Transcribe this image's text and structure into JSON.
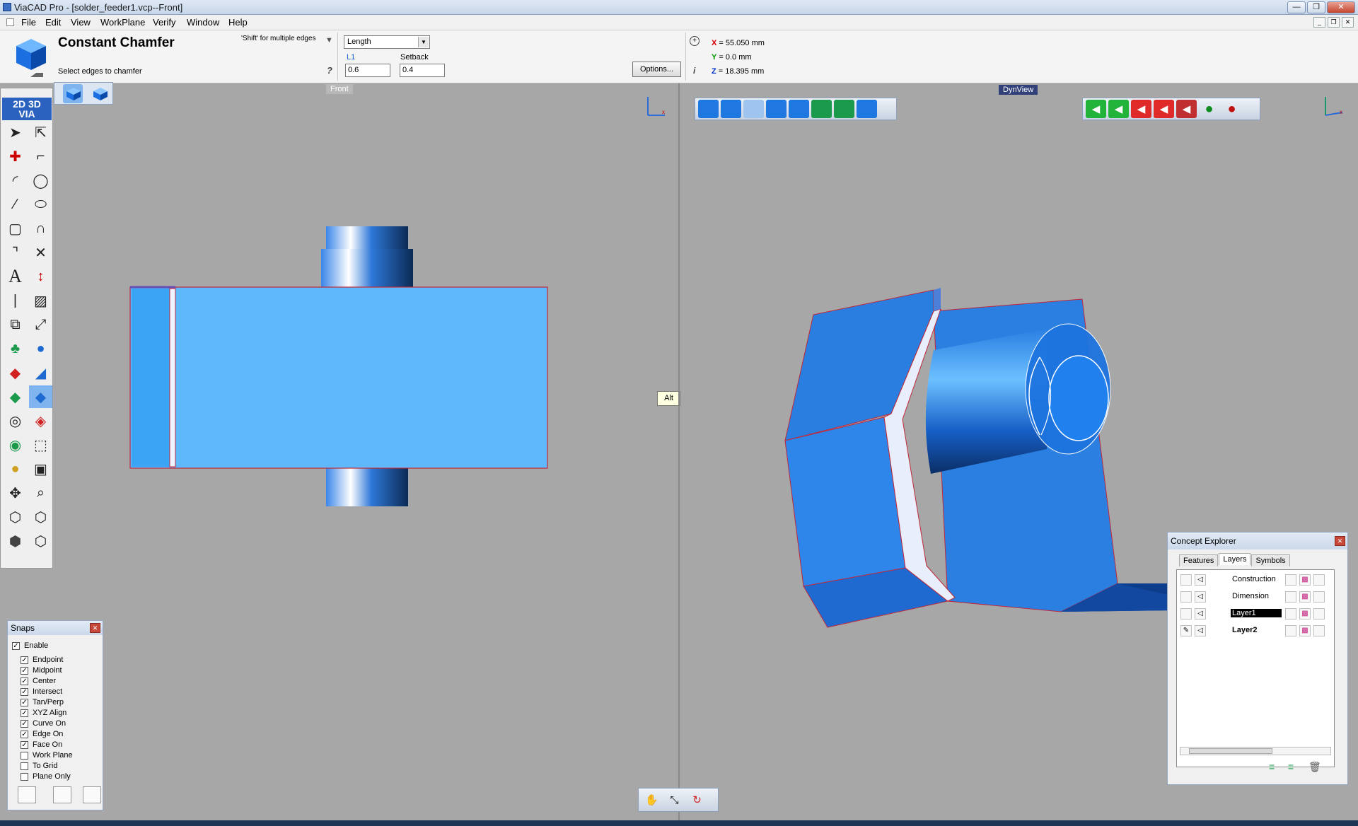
{
  "window": {
    "title": "ViaCAD Pro - [solder_feeder1.vcp--Front]"
  },
  "menu": [
    "File",
    "Edit",
    "View",
    "WorkPlane",
    "Verify",
    "Window",
    "Help"
  ],
  "command": {
    "title": "Constant Chamfer",
    "prompt": "Select edges to chamfer",
    "hint": "'Shift' for multiple edges",
    "help_mark": "?",
    "mode": "Length",
    "l1_label": "L1",
    "l1_value": "0.6",
    "setback_label": "Setback",
    "setback_value": "0.4",
    "options_label": "Options...",
    "info_mark": "i"
  },
  "coords": {
    "x_axis": "X",
    "x_value": " = 55.050 mm",
    "y_axis": "Y",
    "y_value": " = 0.0 mm",
    "z_axis": "Z",
    "z_value": " = 18.395 mm",
    "x_color": "#d40000",
    "y_color": "#009a00",
    "z_color": "#0030c8"
  },
  "viewports": {
    "left_label": "Front",
    "right_label": "DynView"
  },
  "tooltip": "Alt",
  "toolpanel": {
    "logo_top": "2D 3D",
    "logo_bottom": "VIA"
  },
  "snaps": {
    "title": "Snaps",
    "enable_label": "Enable",
    "items": [
      {
        "label": "Endpoint",
        "checked": true
      },
      {
        "label": "Midpoint",
        "checked": true
      },
      {
        "label": "Center",
        "checked": true
      },
      {
        "label": "Intersect",
        "checked": true
      },
      {
        "label": "Tan/Perp",
        "checked": true
      },
      {
        "label": "XYZ Align",
        "checked": true
      },
      {
        "label": "Curve On",
        "checked": true
      },
      {
        "label": "Edge On",
        "checked": true
      },
      {
        "label": "Face On",
        "checked": true
      },
      {
        "label": "Work Plane",
        "checked": false
      },
      {
        "label": "To Grid",
        "checked": false
      },
      {
        "label": "Plane Only",
        "checked": false
      }
    ]
  },
  "concept": {
    "title": "Concept Explorer",
    "tabs": [
      "Features",
      "Layers",
      "Symbols"
    ],
    "active_tab": "Layers",
    "layers": [
      {
        "name": "Construction",
        "selected": false,
        "bold": false
      },
      {
        "name": "Dimension",
        "selected": false,
        "bold": false
      },
      {
        "name": "Layer1",
        "selected": true,
        "bold": false
      },
      {
        "name": "Layer2",
        "selected": false,
        "bold": true
      }
    ]
  }
}
